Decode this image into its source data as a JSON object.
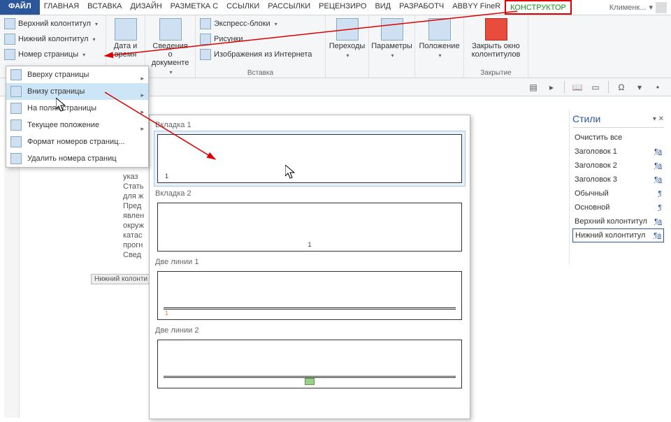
{
  "tabs": {
    "file": "ФАЙЛ",
    "items": [
      "ГЛАВНАЯ",
      "ВСТАВКА",
      "ДИЗАЙН",
      "РАЗМЕТКА С",
      "ССЫЛКИ",
      "РАССЫЛКИ",
      "РЕЦЕНЗИРО",
      "ВИД",
      "РАЗРАБОТЧ",
      "ABBYY FineR"
    ],
    "contextual": "КОНСТРУКТОР",
    "user": "Клименк..."
  },
  "ribbon": {
    "hf": {
      "header": "Верхний колонтитул",
      "footer": "Нижний колонтитул",
      "page_num": "Номер страницы",
      "group": ""
    },
    "datetime": {
      "label": "Дата и время"
    },
    "docinfo": {
      "label": "Сведения о документе"
    },
    "insert_group": "Вставка",
    "quickparts": "Экспресс-блоки",
    "pictures": "Рисунки",
    "online_pics": "Изображения из Интернета",
    "nav": {
      "goto_header": "Переходы",
      "options": "Параметры",
      "position": "Положение"
    },
    "close": {
      "label": "Закрыть окно колонтитулов",
      "group": "Закрытие"
    }
  },
  "menu": {
    "top": "Вверху страницы",
    "bottom": "Внизу страницы",
    "margins": "На полях страницы",
    "current": "Текущее положение",
    "format": "Формат номеров страниц...",
    "remove": "Удалить номера страниц"
  },
  "gallery": {
    "h1": "Вкладка 1",
    "h2": "Вкладка 2",
    "h3": "Две линии 1",
    "h4": "Две линии 2"
  },
  "styles": {
    "title": "Стили",
    "clear": "Очистить все",
    "items": [
      {
        "name": "Заголовок 1",
        "sym": "¶a"
      },
      {
        "name": "Заголовок 2",
        "sym": "¶a"
      },
      {
        "name": "Заголовок 3",
        "sym": "¶a"
      },
      {
        "name": "Обычный",
        "sym": "¶"
      },
      {
        "name": "Основной",
        "sym": "¶"
      },
      {
        "name": "Верхний колонтитул",
        "sym": "¶a"
      },
      {
        "name": "Нижний колонтитул",
        "sym": "¶a"
      }
    ]
  },
  "doc": {
    "snippet": "указ\nСтать\nдля ж\nПред\nявлен\nокруж\nкатас\nпрогн\nСвед",
    "footer_label": "Нижний колонти"
  }
}
